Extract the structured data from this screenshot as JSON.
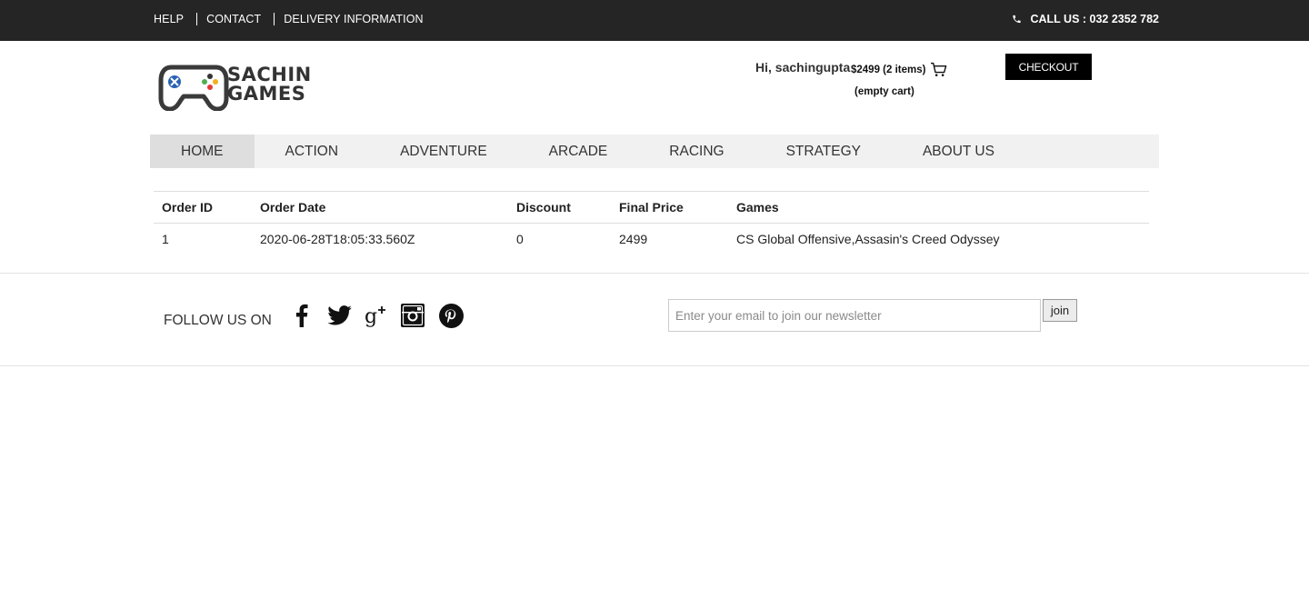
{
  "topbar": {
    "links": [
      "HELP",
      "CONTACT",
      "DELIVERY INFORMATION"
    ],
    "call_us": "CALL US : 032 2352 782",
    "phone_icon": "phone-icon"
  },
  "header": {
    "logo_line1": "SACHIN",
    "logo_line2": "GAMES",
    "greeting": "Hi, sachingupta",
    "cart_summary": "$2499 (2 items)",
    "cart_icon": "cart-icon",
    "empty_cart": "(empty cart)",
    "checkout_label": "CHECKOUT"
  },
  "nav": {
    "items": [
      "HOME",
      "ACTION",
      "ADVENTURE",
      "ARCADE",
      "RACING",
      "STRATEGY",
      "ABOUT US"
    ],
    "active": "HOME"
  },
  "orders": {
    "headers": [
      "Order ID",
      "Order Date",
      "Discount",
      "Final Price",
      "Games"
    ],
    "rows": [
      [
        "1",
        "2020-06-28T18:05:33.560Z",
        "0",
        "2499",
        "CS Global Offensive,Assasin's Creed Odyssey"
      ]
    ]
  },
  "footer": {
    "follow_label": "FOLLOW US ON",
    "social_icons": [
      "facebook-icon",
      "twitter-icon",
      "google-plus-icon",
      "instagram-icon",
      "pinterest-icon"
    ],
    "newsletter_placeholder": "Enter your email to join our newsletter",
    "join_label": "join"
  },
  "colors": {
    "topbar_bg": "#252525",
    "nav_bg": "#f1f1f1",
    "nav_active_bg": "#dedede",
    "checkout_bg": "#000000"
  }
}
